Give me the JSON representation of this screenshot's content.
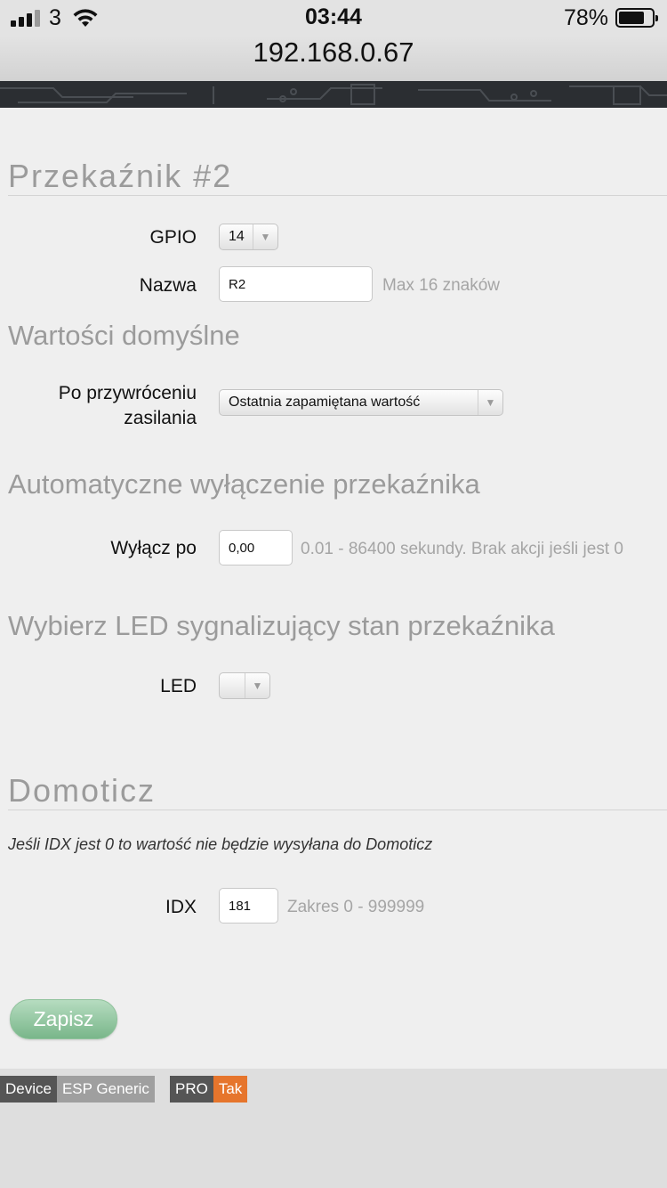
{
  "status_bar": {
    "carrier": "3",
    "time": "03:44",
    "battery_percent": "78%",
    "battery_level": 0.78,
    "signal_bars": 3
  },
  "browser": {
    "url": "192.168.0.67"
  },
  "form": {
    "title": "Przekaźnik #2",
    "gpio_label": "GPIO",
    "gpio_value": "14",
    "name_label": "Nazwa",
    "name_value": "R2",
    "name_hint": "Max 16 znaków",
    "defaults_title": "Wartości domyślne",
    "power_restore_label_line1": "Po przywróceniu",
    "power_restore_label_line2": "zasilania",
    "power_restore_value": "Ostatnia zapamiętana wartość",
    "auto_off_title": "Automatyczne wyłączenie przekaźnika",
    "off_after_label": "Wyłącz po",
    "off_after_value": "0,00",
    "off_after_hint": "0.01 - 86400 sekundy. Brak akcji jeśli jest 0",
    "led_title": "Wybierz LED sygnalizujący stan przekaźnika",
    "led_label": "LED",
    "led_value": "",
    "domoticz_title": "Domoticz",
    "domoticz_note": "Jeśli IDX jest 0 to wartość nie będzie wysyłana do Domoticz",
    "idx_label": "IDX",
    "idx_value": "181",
    "idx_hint": "Zakres 0 - 999999",
    "save_label": "Zapisz"
  },
  "footer": {
    "device_label": "Device",
    "device_value": "ESP Generic",
    "pro_label": "PRO",
    "pro_value": "Tak"
  },
  "colors": {
    "save_button": "#79b68a",
    "pro_badge": "#e6752c",
    "section_title": "#9b9b9b"
  }
}
